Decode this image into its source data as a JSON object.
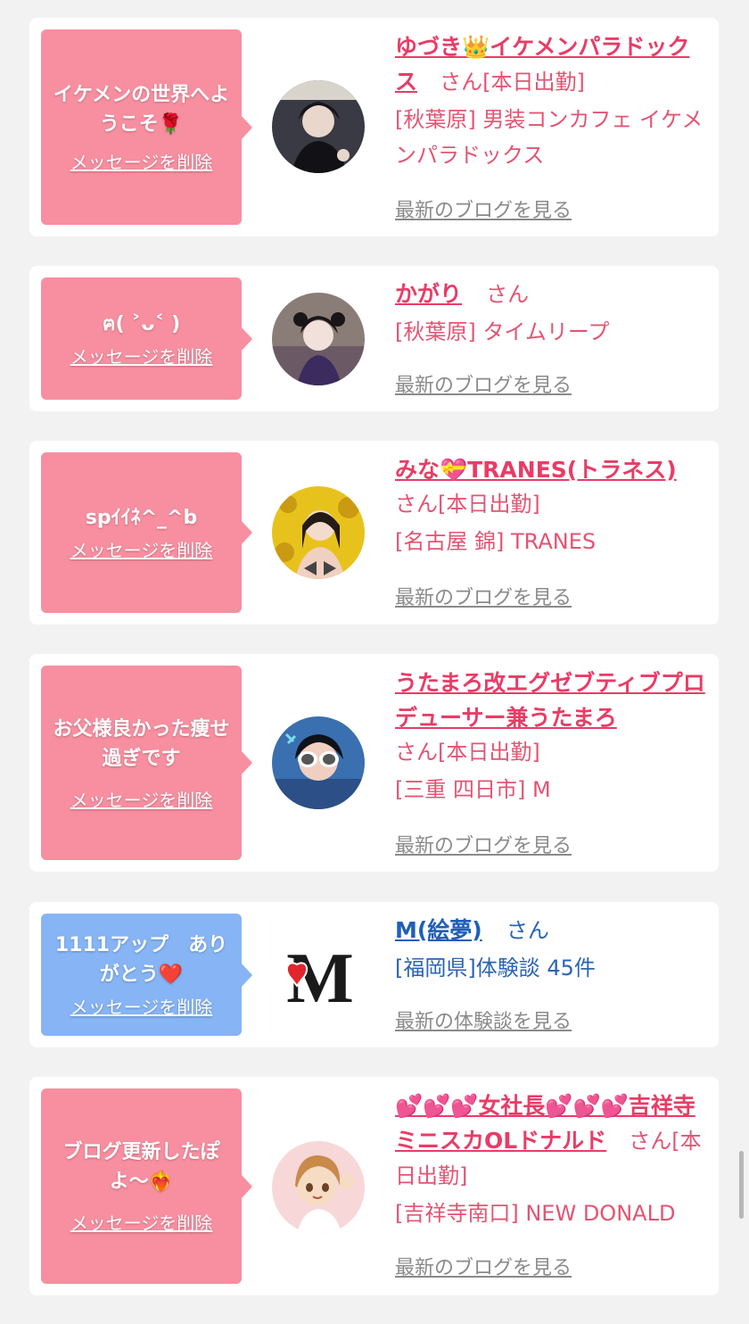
{
  "entries": [
    {
      "message": "イケメンの世界へようこそ🌹",
      "delete_label": "メッセージを削除",
      "name": "ゆづき👑イケメンパラドックス",
      "san": "さん",
      "status": "[本日出勤]",
      "location": "[秋葉原] 男装コンカフェ イケメンパラドックス",
      "link": "最新のブログを見る",
      "avatar_icon": "profile-photo-icon"
    },
    {
      "message": "ฅ(  ˃ᴗ˂ )",
      "delete_label": "メッセージを削除",
      "name": "かがり",
      "san": "さん",
      "status": "",
      "location": "[秋葉原] タイムリープ",
      "link": "最新のブログを見る",
      "avatar_icon": "profile-photo-icon"
    },
    {
      "message": "spｲｲﾈ^_^b",
      "delete_label": "メッセージを削除",
      "name": "みな💝TRANES(トラネス)",
      "san": "さん",
      "status": "[本日出勤]",
      "location": "[名古屋 錦] TRANES",
      "link": "最新のブログを見る",
      "avatar_icon": "profile-photo-icon"
    },
    {
      "message": "お父様良かった痩せ過ぎです",
      "delete_label": "メッセージを削除",
      "name": "うたまろ改エグゼブティブプロデューサー兼うたまろ",
      "san": "さん",
      "status": "[本日出勤]",
      "location": "[三重 四日市] M",
      "link": "最新のブログを見る",
      "avatar_icon": "profile-photo-icon"
    },
    {
      "message": "1111アップ　ありがとう❤️",
      "delete_label": "メッセージを削除",
      "name": "M(絵夢)",
      "san": "さん",
      "status": "",
      "location": "[福岡県]体験談 45件",
      "link": "最新の体験談を見る",
      "avatar_icon": "m-logo-icon"
    },
    {
      "message": "ブログ更新したぽよ〜❤️‍🔥",
      "delete_label": "メッセージを削除",
      "name": "💕💕💕女社長💕💕💕吉祥寺ミニスカOLドナルド",
      "san": "さん",
      "status": "[本日出勤]",
      "location": "[吉祥寺南口] NEW DONALD",
      "link": "最新のブログを見る",
      "avatar_icon": "profile-illustration-icon"
    }
  ],
  "colors": {
    "pink_bubble": "#f78fa0",
    "blue_bubble": "#86b4f4",
    "pink_text": "#e83c66",
    "blue_text": "#1f5fb8"
  }
}
